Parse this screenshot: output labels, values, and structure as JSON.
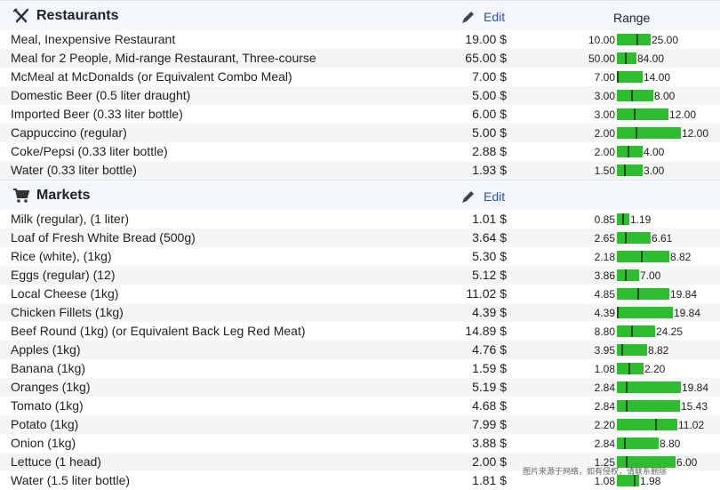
{
  "sections": [
    {
      "title": "Restaurants",
      "icon": "fork-knife-icon",
      "edit_label": "Edit",
      "range_label": "Range",
      "items": [
        {
          "name": "Meal, Inexpensive Restaurant",
          "price": "19.00 $",
          "min": "10.00",
          "max": "25.00"
        },
        {
          "name": "Meal for 2 People, Mid-range Restaurant, Three-course",
          "price": "65.00 $",
          "min": "50.00",
          "max": "84.00"
        },
        {
          "name": "McMeal at McDonalds (or Equivalent Combo Meal)",
          "price": "7.00 $",
          "min": "7.00",
          "max": "14.00"
        },
        {
          "name": "Domestic Beer (0.5 liter draught)",
          "price": "5.00 $",
          "min": "3.00",
          "max": "8.00"
        },
        {
          "name": "Imported Beer (0.33 liter bottle)",
          "price": "6.00 $",
          "min": "3.00",
          "max": "12.00"
        },
        {
          "name": "Cappuccino (regular)",
          "price": "5.00 $",
          "min": "2.00",
          "max": "12.00"
        },
        {
          "name": "Coke/Pepsi (0.33 liter bottle)",
          "price": "2.88 $",
          "min": "2.00",
          "max": "4.00"
        },
        {
          "name": "Water (0.33 liter bottle)",
          "price": "1.93 $",
          "min": "1.50",
          "max": "3.00"
        }
      ]
    },
    {
      "title": "Markets",
      "icon": "cart-icon",
      "edit_label": "Edit",
      "range_label": "",
      "items": [
        {
          "name": "Milk (regular), (1 liter)",
          "price": "1.01 $",
          "min": "0.85",
          "max": "1.19"
        },
        {
          "name": "Loaf of Fresh White Bread (500g)",
          "price": "3.64 $",
          "min": "2.65",
          "max": "6.61"
        },
        {
          "name": "Rice (white), (1kg)",
          "price": "5.30 $",
          "min": "2.18",
          "max": "8.82"
        },
        {
          "name": "Eggs (regular) (12)",
          "price": "5.12 $",
          "min": "3.86",
          "max": "7.00"
        },
        {
          "name": "Local Cheese (1kg)",
          "price": "11.02 $",
          "min": "4.85",
          "max": "19.84"
        },
        {
          "name": "Chicken Fillets (1kg)",
          "price": "4.39 $",
          "min": "4.39",
          "max": "19.84"
        },
        {
          "name": "Beef Round (1kg) (or Equivalent Back Leg Red Meat)",
          "price": "14.89 $",
          "min": "8.80",
          "max": "24.25"
        },
        {
          "name": "Apples (1kg)",
          "price": "4.76 $",
          "min": "3.95",
          "max": "8.82"
        },
        {
          "name": "Banana (1kg)",
          "price": "1.59 $",
          "min": "1.08",
          "max": "2.20"
        },
        {
          "name": "Oranges (1kg)",
          "price": "5.19 $",
          "min": "2.84",
          "max": "19.84"
        },
        {
          "name": "Tomato (1kg)",
          "price": "4.68 $",
          "min": "2.84",
          "max": "15.43"
        },
        {
          "name": "Potato (1kg)",
          "price": "7.99 $",
          "min": "2.20",
          "max": "11.02"
        },
        {
          "name": "Onion (1kg)",
          "price": "3.88 $",
          "min": "2.84",
          "max": "8.80"
        },
        {
          "name": "Lettuce (1 head)",
          "price": "2.00 $",
          "min": "1.25",
          "max": "6.00"
        },
        {
          "name": "Water (1.5 liter bottle)",
          "price": "1.81 $",
          "min": "1.08",
          "max": "1.98"
        }
      ]
    }
  ],
  "colors": {
    "bar": "#2ebd2e",
    "marker": "#1a4f1a",
    "link": "#2a51b5",
    "header_bg": "#f3f7fc"
  },
  "watermark": "图片来源于网络，如有侵权，请联系删除"
}
